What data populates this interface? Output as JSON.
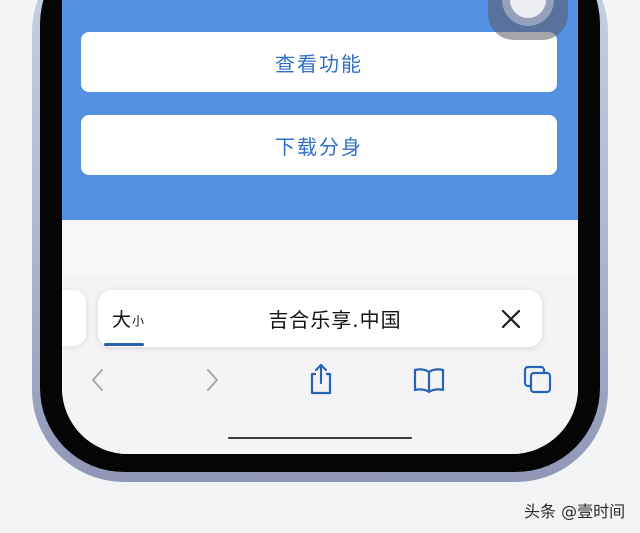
{
  "page_buttons": {
    "view_features": "查看功能",
    "download_clone": "下载分身"
  },
  "address_bar": {
    "text_size_label_big": "大",
    "text_size_label_small": "小",
    "domain": "吉合乐享.中国",
    "close_icon": "close-icon"
  },
  "toolbar": {
    "icons": [
      "back-icon",
      "forward-icon",
      "share-icon",
      "bookmarks-icon",
      "tabs-icon"
    ]
  },
  "watermark": "头条 @壹时间",
  "colors": {
    "accent_blue": "#5591e3",
    "button_text": "#2f70c9",
    "toolbar_icon": "#2a62b7",
    "toolbar_disabled": "#a8a8ae"
  }
}
